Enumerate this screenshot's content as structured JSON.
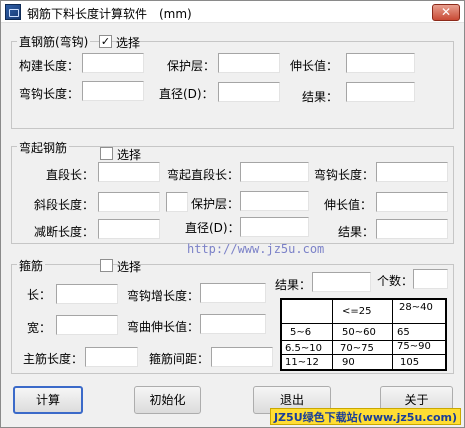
{
  "window": {
    "title": "钢筋下料长度计算软件　(mm)",
    "close": "✕"
  },
  "straight": {
    "group_title": "直钢筋(弯钩)",
    "checkbox_checked": true,
    "checkbox_label": "选择",
    "labels": {
      "member_length": "构建长度：",
      "cover": "保护层：",
      "elongation": "伸长值：",
      "hook_length": "弯钩长度：",
      "diameter": "直径(D)：",
      "result": "结果："
    }
  },
  "bent": {
    "group_title": "弯起钢筋",
    "checkbox_checked": false,
    "checkbox_label": "选择",
    "labels": {
      "straight_len": "直段长：",
      "bent_straight_len": "弯起直段长：",
      "hook_length": "弯钩长度：",
      "oblique_len": "斜段长度：",
      "cover": "保护层：",
      "elongation": "伸长值：",
      "cut_length": "减断长度：",
      "diameter": "直径(D)：",
      "result": "结果："
    }
  },
  "url_text": "http://www.jz5u.com",
  "stirrup": {
    "group_title": "箍筋",
    "checkbox_checked": false,
    "checkbox_label": "选择",
    "labels": {
      "length": "长：",
      "hook_add": "弯钩增长度：",
      "result": "结果：",
      "count": "个数：",
      "width": "宽：",
      "bend_elong": "弯曲伸长值：",
      "main_len": "主筋长度：",
      "spacing": "箍筋间距："
    },
    "table": {
      "header": [
        "",
        "<=25",
        "28~40"
      ],
      "rows": [
        [
          "5~6",
          "50~60",
          "65"
        ],
        [
          "6.5~10",
          "70~75",
          "75~90"
        ],
        [
          "11~12",
          "90",
          "105"
        ]
      ]
    }
  },
  "buttons": {
    "calc": "计算",
    "init": "初始化",
    "exit": "退出",
    "about": "关于"
  },
  "watermark": "JZ5U绿色下载站(www.jz5u.com)"
}
